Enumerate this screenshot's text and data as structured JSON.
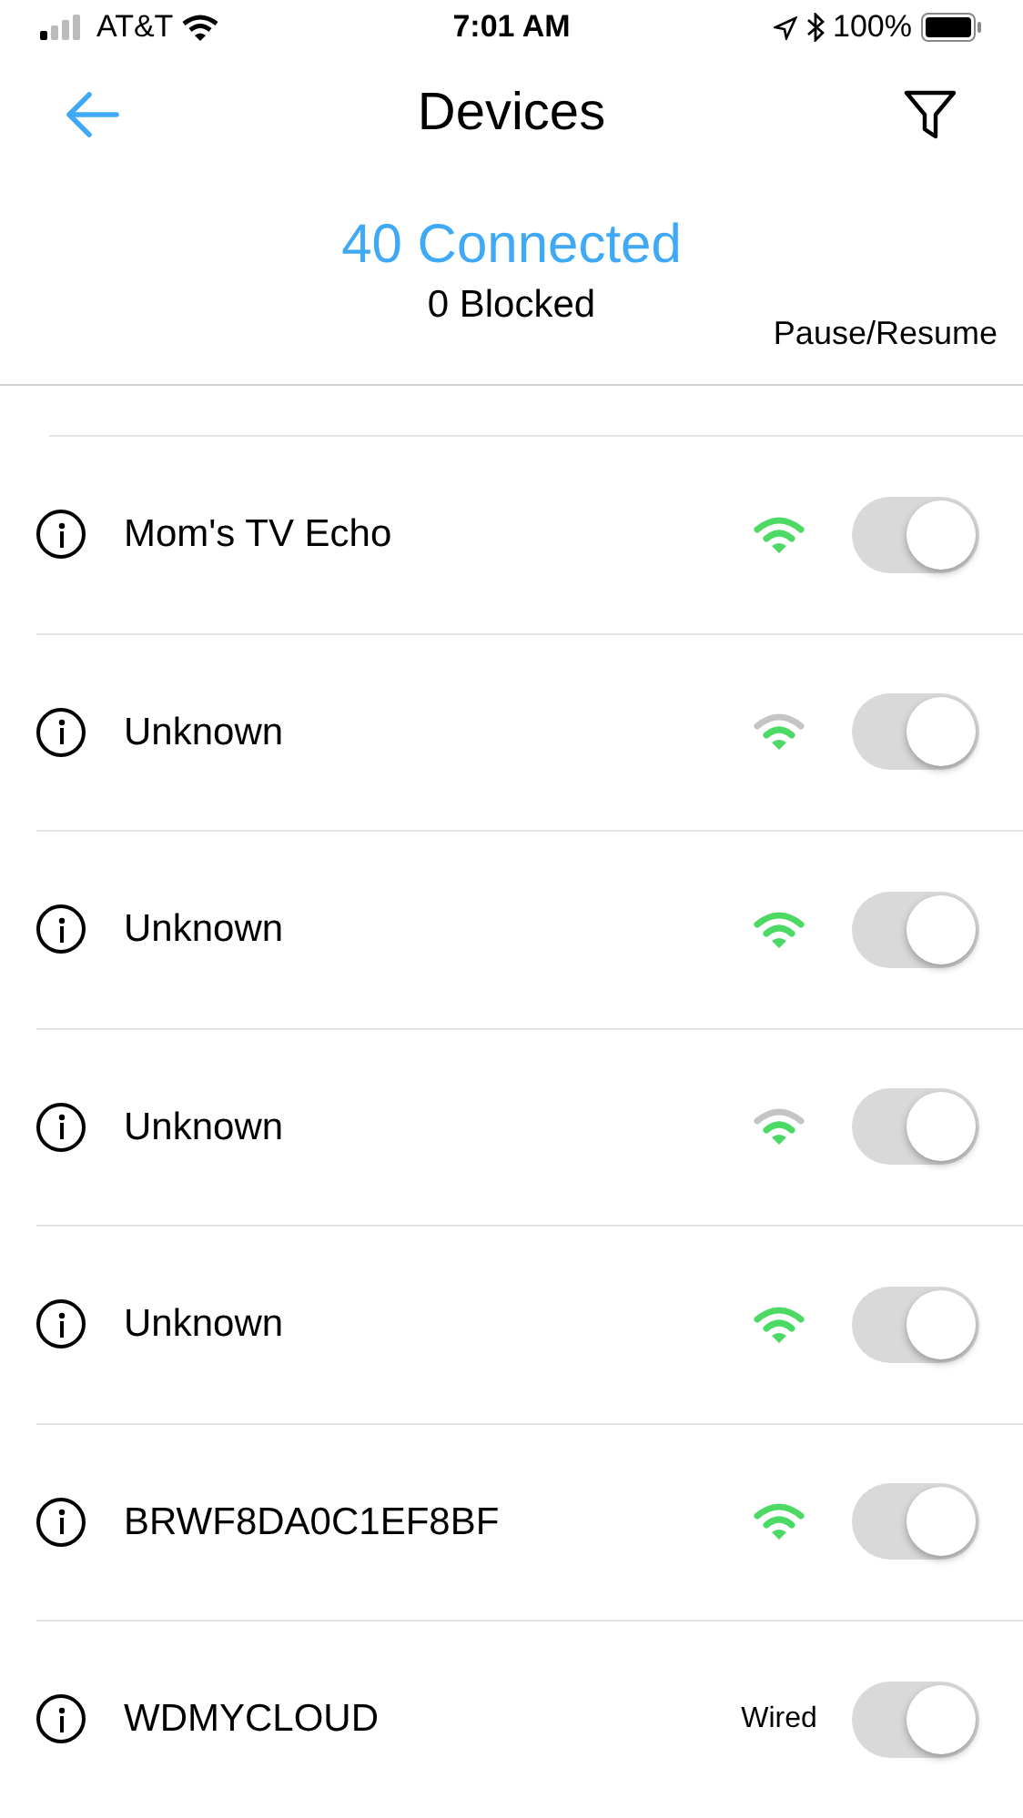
{
  "status_bar": {
    "carrier": "AT&T",
    "time": "7:01 AM",
    "battery": "100%"
  },
  "header": {
    "title": "Devices"
  },
  "summary": {
    "connected": "40 Connected",
    "blocked": "0 Blocked",
    "pause_label": "Pause/Resume"
  },
  "devices": [
    {
      "name": "Mom's TV Echo",
      "kind": "wifi",
      "on": true
    },
    {
      "name": "Unknown",
      "kind": "weakwifi",
      "on": true
    },
    {
      "name": "Unknown",
      "kind": "wifi",
      "on": true
    },
    {
      "name": "Unknown",
      "kind": "weakwifi",
      "on": true
    },
    {
      "name": "Unknown",
      "kind": "wifi",
      "on": true
    },
    {
      "name": "BRWF8DA0C1EF8BF",
      "kind": "wifi",
      "on": true
    },
    {
      "name": "WDMYCLOUD",
      "kind": "wired",
      "connection_label": "Wired",
      "on": true
    }
  ]
}
